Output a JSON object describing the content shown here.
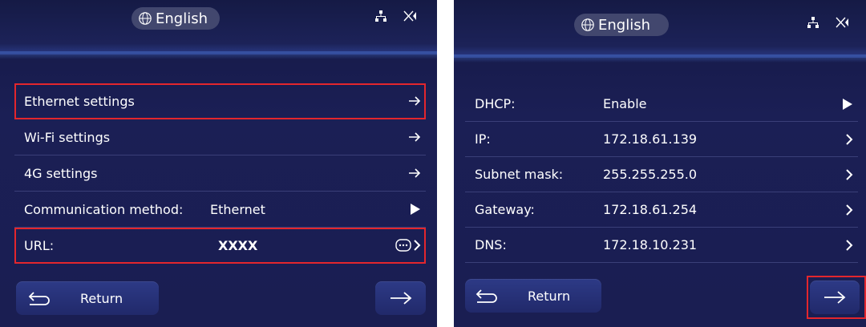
{
  "left_screen": {
    "language": "English",
    "rows": [
      {
        "label": "Ethernet settings"
      },
      {
        "label": "Wi-Fi settings"
      },
      {
        "label": "4G settings"
      },
      {
        "label": "Communication method:",
        "value": "Ethernet"
      },
      {
        "label": "URL:",
        "value": "XXXX"
      }
    ],
    "return_label": "Return"
  },
  "right_screen": {
    "language": "English",
    "rows": [
      {
        "label": "DHCP:",
        "value": "Enable"
      },
      {
        "label": "IP:",
        "value": "172.18.61.139"
      },
      {
        "label": "Subnet mask:",
        "value": "255.255.255.0"
      },
      {
        "label": "Gateway:",
        "value": "172.18.61.254"
      },
      {
        "label": "DNS:",
        "value": "172.18.10.231"
      }
    ],
    "return_label": "Return"
  },
  "colors": {
    "background": "#1a1e52",
    "highlight": "#e3262d",
    "button": "#2d3a86"
  },
  "icons": [
    "globe-icon",
    "network-icon",
    "no-signal-icon",
    "arrow-right-icon",
    "chevron-right-icon",
    "play-icon",
    "more-icon",
    "return-icon"
  ]
}
